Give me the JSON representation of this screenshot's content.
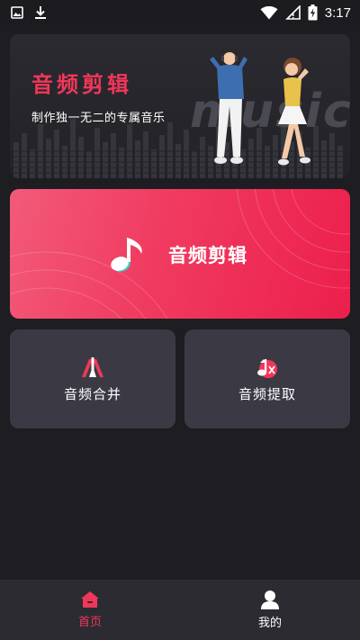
{
  "status_bar": {
    "time": "3:17",
    "icons": [
      "image-icon",
      "download-icon",
      "wifi-icon",
      "signal-icon",
      "battery-charging-icon"
    ]
  },
  "banner": {
    "title": "音频剪辑",
    "subtitle": "制作独一无二的专属音乐",
    "watermark": "music",
    "accent_color": "#f0375a"
  },
  "main_card": {
    "label": "音频剪辑",
    "icon": "music-note-icon",
    "gradient": [
      "#f25a79",
      "#ec1f4c"
    ]
  },
  "tools": [
    {
      "label": "音频合并",
      "icon": "merge-icon"
    },
    {
      "label": "音频提取",
      "icon": "extract-icon"
    }
  ],
  "bottom_nav": {
    "items": [
      {
        "label": "首页",
        "icon": "home-icon",
        "active": true
      },
      {
        "label": "我的",
        "icon": "profile-icon",
        "active": false
      }
    ],
    "active_color": "#f0375a"
  }
}
